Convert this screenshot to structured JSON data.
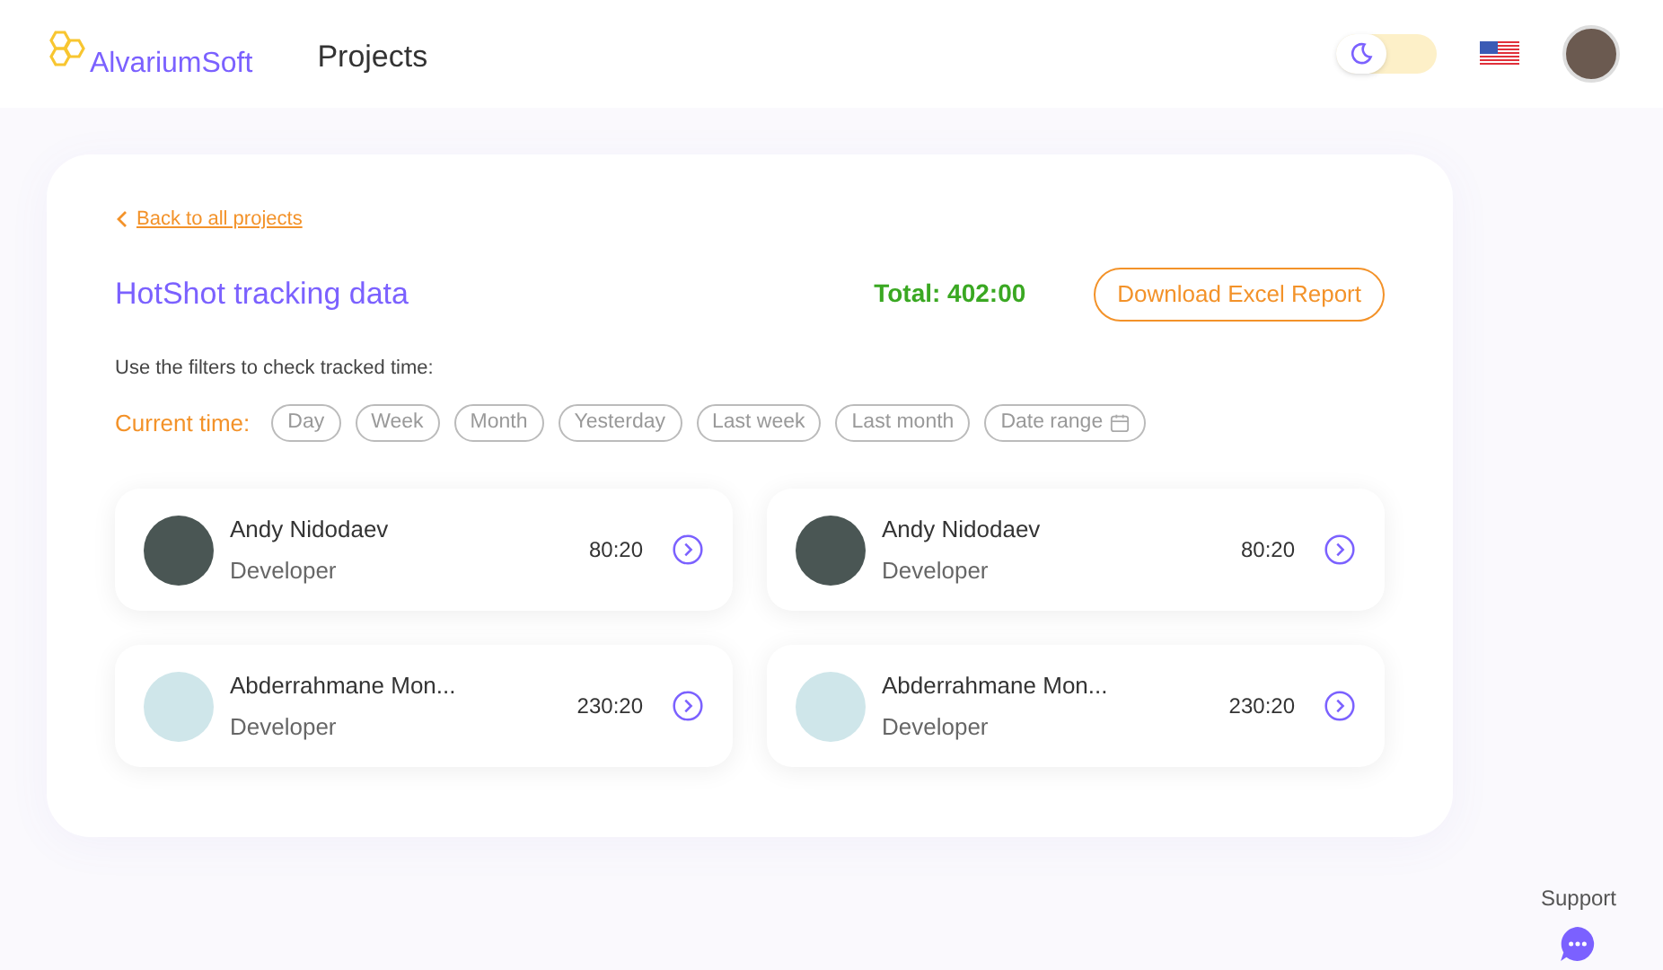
{
  "header": {
    "brand": "AlvariumSoft",
    "title": "Projects",
    "theme_toggle": {
      "on": false
    }
  },
  "back_link": "Back to all projects",
  "project": {
    "title": "HotShot tracking data",
    "total": "Total: 402:00",
    "download": "Download Excel Report"
  },
  "hint": "Use the filters to check tracked time:",
  "filters": {
    "label": "Current time:",
    "items": [
      {
        "label": "Day",
        "selected": false,
        "kind": "plain"
      },
      {
        "label": "Week",
        "selected": false,
        "kind": "plain"
      },
      {
        "label": "Month",
        "selected": false,
        "kind": "plain"
      },
      {
        "label": "Yesterday",
        "selected": false,
        "kind": "plain"
      },
      {
        "label": "Last week",
        "selected": false,
        "kind": "plain"
      },
      {
        "label": "Last month",
        "selected": false,
        "kind": "plain"
      },
      {
        "label": "Date range",
        "selected": false,
        "kind": "date"
      }
    ]
  },
  "members": [
    {
      "name": "Andy Nidodaev",
      "role": "Developer",
      "time": "80:20",
      "kind": "dark"
    },
    {
      "name": "Andy Nidodaev",
      "role": "Developer",
      "time": "80:20",
      "kind": "dark"
    },
    {
      "name": "Abderrahmane Mon...",
      "role": "Developer",
      "time": "230:20",
      "kind": "light"
    },
    {
      "name": "Abderrahmane Mon...",
      "role": "Developer",
      "time": "230:20",
      "kind": "light"
    }
  ],
  "support": "Support"
}
